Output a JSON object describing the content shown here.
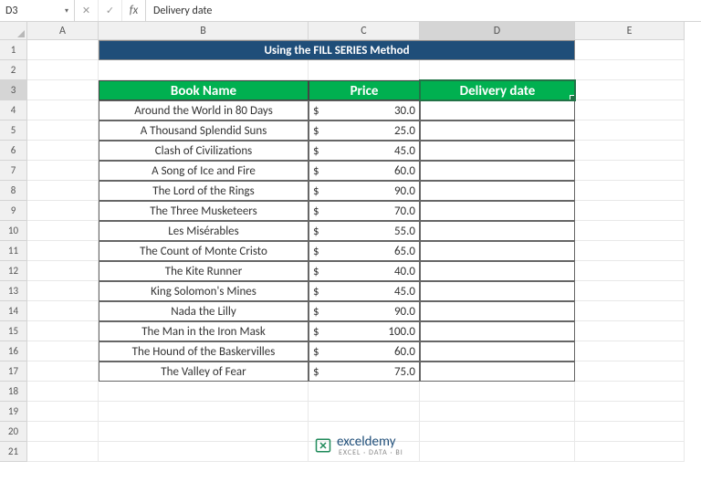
{
  "formula_bar": {
    "cell_ref": "D3",
    "fx_label": "fx",
    "value": "Delivery date"
  },
  "columns": [
    "A",
    "B",
    "C",
    "D",
    "E"
  ],
  "selected_col": "D",
  "rows": [
    "1",
    "2",
    "3",
    "4",
    "5",
    "6",
    "7",
    "8",
    "9",
    "10",
    "11",
    "12",
    "13",
    "14",
    "15",
    "16",
    "17",
    "18",
    "19",
    "20",
    "21"
  ],
  "selected_row": "3",
  "title_text": "Using the FILL SERIES Method",
  "headers": {
    "book": "Book Name",
    "price": "Price",
    "delivery": "Delivery date"
  },
  "currency_symbol": "$",
  "chart_data": {
    "type": "table",
    "columns": [
      "Book Name",
      "Price"
    ],
    "rows": [
      {
        "book": "Around the World in 80 Days",
        "price": "30.0"
      },
      {
        "book": "A Thousand Splendid Suns",
        "price": "25.0"
      },
      {
        "book": "Clash of Civilizations",
        "price": "45.0"
      },
      {
        "book": "A Song of Ice and Fire",
        "price": "60.0"
      },
      {
        "book": "The Lord of the Rings",
        "price": "90.0"
      },
      {
        "book": "The Three Musketeers",
        "price": "70.0"
      },
      {
        "book": "Les Misérables",
        "price": "55.0"
      },
      {
        "book": "The Count of Monte Cristo",
        "price": "65.0"
      },
      {
        "book": "The Kite Runner",
        "price": "40.0"
      },
      {
        "book": "King Solomon's Mines",
        "price": "45.0"
      },
      {
        "book": "Nada the Lilly",
        "price": "90.0"
      },
      {
        "book": "The Man in the Iron Mask",
        "price": "100.0"
      },
      {
        "book": "The Hound of the Baskervilles",
        "price": "60.0"
      },
      {
        "book": "The Valley of Fear",
        "price": "75.0"
      }
    ]
  },
  "brand": {
    "name": "exceldemy",
    "tag": "EXCEL · DATA · BI"
  }
}
